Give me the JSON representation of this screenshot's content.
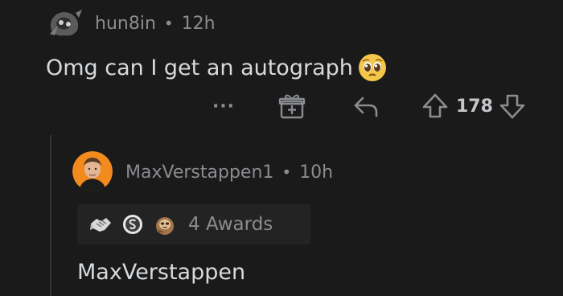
{
  "parent_comment": {
    "username": "hun8in",
    "separator": "•",
    "age": "12h",
    "body": "Omg can I get an autograph",
    "emoji": "pleading-face-icon",
    "more_label": "···",
    "vote_count": "178"
  },
  "reply_comment": {
    "username": "MaxVerstappen1",
    "separator": "•",
    "age": "10h",
    "awards_label": "4 Awards",
    "body": "MaxVerstappen"
  },
  "colors": {
    "background": "#1a1a1b",
    "text_primary": "#d7dadc",
    "text_meta": "#8a8c8f",
    "thread_line": "#343536",
    "award_bg": "#232324"
  }
}
